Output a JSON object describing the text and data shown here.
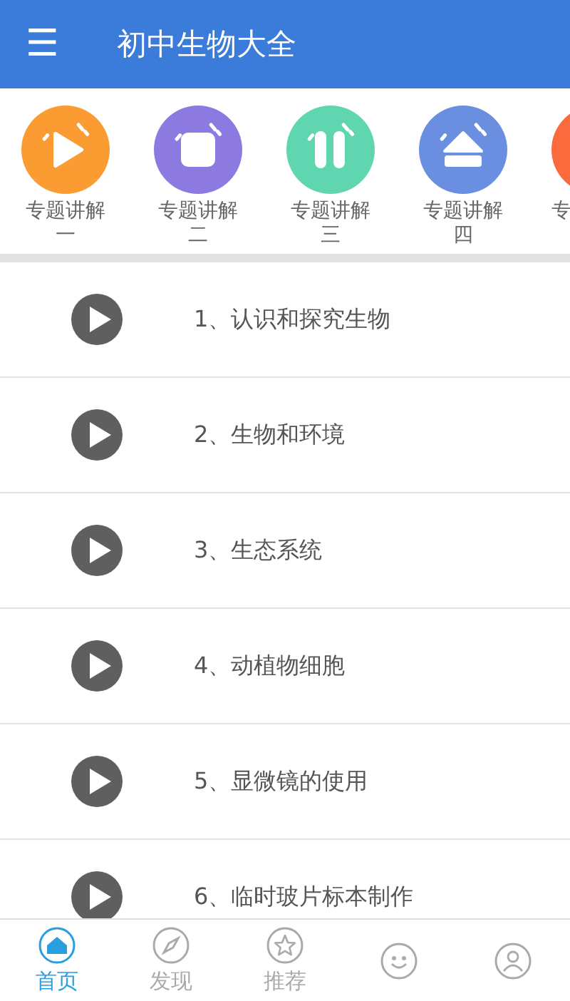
{
  "header": {
    "menu_icon": "☰",
    "title": "初中生物大全"
  },
  "categories": [
    {
      "label": "专题讲解一",
      "kind": "play",
      "color": "#fb9c33"
    },
    {
      "label": "专题讲解二",
      "kind": "stop",
      "color": "#8c7ae0"
    },
    {
      "label": "专题讲解三",
      "kind": "pause",
      "color": "#5fd6b0"
    },
    {
      "label": "专题讲解四",
      "kind": "eject",
      "color": "#6a8fe0"
    },
    {
      "label": "专",
      "kind": "blank",
      "color": "#fb6a3d"
    }
  ],
  "lessons": [
    {
      "title": "1、认识和探究生物"
    },
    {
      "title": "2、生物和环境"
    },
    {
      "title": "3、生态系统"
    },
    {
      "title": "4、动植物细胞"
    },
    {
      "title": "5、显微镜的使用"
    },
    {
      "title": "6、临时玻片标本制作"
    }
  ],
  "tabs": [
    {
      "label": "首页",
      "kind": "home",
      "selected": true
    },
    {
      "label": "发现",
      "kind": "compass",
      "selected": false
    },
    {
      "label": "推荐",
      "kind": "star",
      "selected": false
    },
    {
      "kind": "face",
      "selected": false
    },
    {
      "kind": "user",
      "selected": false
    }
  ]
}
